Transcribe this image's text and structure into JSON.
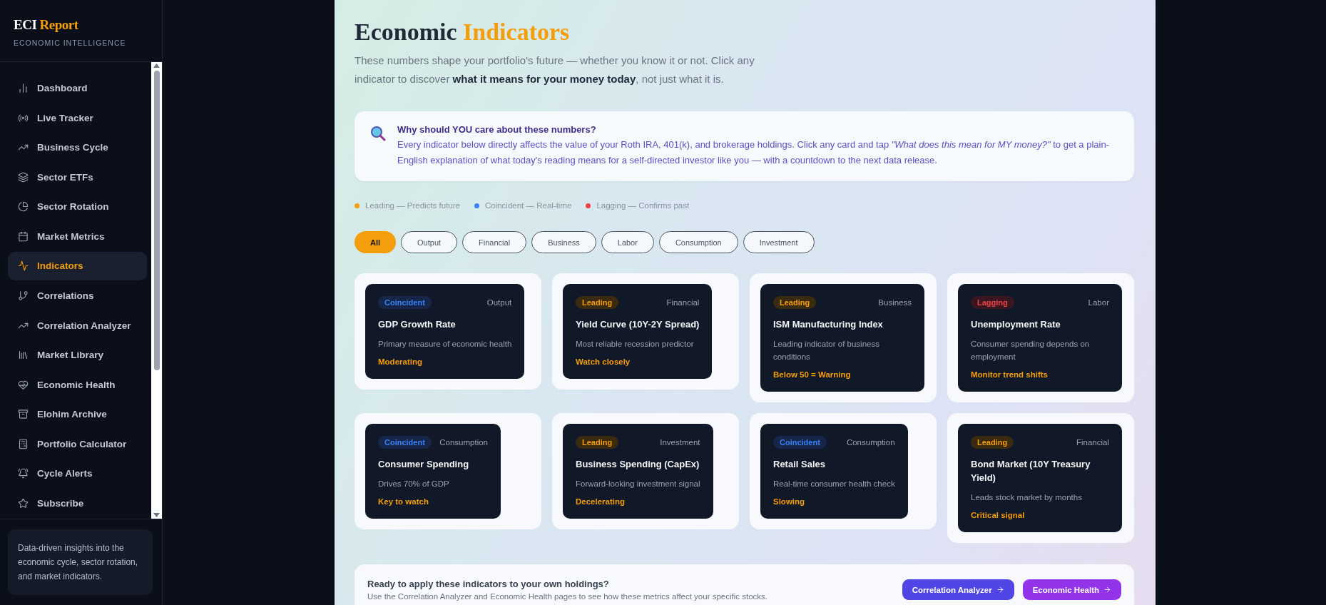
{
  "sidebar": {
    "logo": {
      "primary": "ECI",
      "accent": "Report"
    },
    "subtitle": "ECONOMIC INTELLIGENCE",
    "items": [
      {
        "label": "Dashboard",
        "selected": false
      },
      {
        "label": "Live Tracker",
        "selected": false
      },
      {
        "label": "Business Cycle",
        "selected": false
      },
      {
        "label": "Sector ETFs",
        "selected": false
      },
      {
        "label": "Sector Rotation",
        "selected": false
      },
      {
        "label": "Market Metrics",
        "selected": false
      },
      {
        "label": "Indicators",
        "selected": true
      },
      {
        "label": "Correlations",
        "selected": false
      },
      {
        "label": "Correlation Analyzer",
        "selected": false
      },
      {
        "label": "Market Library",
        "selected": false
      },
      {
        "label": "Economic Health",
        "selected": false
      },
      {
        "label": "Elohim Archive",
        "selected": false
      },
      {
        "label": "Portfolio Calculator",
        "selected": false
      },
      {
        "label": "Cycle Alerts",
        "selected": false
      },
      {
        "label": "Subscribe",
        "selected": false
      }
    ],
    "footer": "Data-driven insights into the economic cycle, sector rotation, and market indicators."
  },
  "header": {
    "title": "Economic",
    "title_accent": "Indicators",
    "intro": "These numbers shape your portfolio's future — whether you know it or not. Click any indicator to discover **what it means for your money today**, not just what it is."
  },
  "info": {
    "title": "Why should YOU care about these numbers?",
    "body": "Every indicator below directly affects the value of your Roth IRA, 401(k), and brokerage holdings. Click any card and tap *\"What does this mean for MY money?\"* to get a plain-English explanation of what today's reading means for a self-directed investor like you — with a countdown to the next data release."
  },
  "legend": [
    {
      "label": "Leading — Predicts future",
      "color": "#f59e0b"
    },
    {
      "label": "Coincident — Real-time",
      "color": "#3b82f6"
    },
    {
      "label": "Lagging — Confirms past",
      "color": "#ef4444"
    }
  ],
  "filters": [
    {
      "label": "All",
      "selected": true
    },
    {
      "label": "Output",
      "selected": false
    },
    {
      "label": "Financial",
      "selected": false
    },
    {
      "label": "Business",
      "selected": false
    },
    {
      "label": "Labor",
      "selected": false
    },
    {
      "label": "Consumption",
      "selected": false
    },
    {
      "label": "Investment",
      "selected": false
    }
  ],
  "cards": [
    {
      "kind": "coincident",
      "badge": "Coincident",
      "sector": "Output",
      "title": "GDP Growth Rate",
      "description": "Primary measure of economic health",
      "signal": "Moderating"
    },
    {
      "kind": "leading",
      "badge": "Leading",
      "sector": "Financial",
      "title": "Yield Curve (10Y-2Y Spread)",
      "description": "Most reliable recession predictor",
      "signal": "Watch closely"
    },
    {
      "kind": "leading",
      "badge": "Leading",
      "sector": "Business",
      "title": "ISM Manufacturing Index",
      "description": "Leading indicator of business conditions",
      "signal": "Below 50 = Warning"
    },
    {
      "kind": "lagging",
      "badge": "Lagging",
      "sector": "Labor",
      "title": "Unemployment Rate",
      "description": "Consumer spending depends on employment",
      "signal": "Monitor trend shifts"
    },
    {
      "kind": "coincident",
      "badge": "Coincident",
      "sector": "Consumption",
      "title": "Consumer Spending",
      "description": "Drives 70% of GDP",
      "signal": "Key to watch"
    },
    {
      "kind": "leading",
      "badge": "Leading",
      "sector": "Investment",
      "title": "Business Spending (CapEx)",
      "description": "Forward-looking investment signal",
      "signal": "Decelerating"
    },
    {
      "kind": "coincident",
      "badge": "Coincident",
      "sector": "Consumption",
      "title": "Retail Sales",
      "description": "Real-time consumer health check",
      "signal": "Slowing"
    },
    {
      "kind": "leading",
      "badge": "Leading",
      "sector": "Financial",
      "title": "Bond Market (10Y Treasury Yield)",
      "description": "Leads stock market by months",
      "signal": "Critical signal"
    }
  ],
  "cta": {
    "title": "Ready to apply these indicators to your own holdings?",
    "text": "Use the Correlation Analyzer and Economic Health pages to see how these metrics affect your specific stocks.",
    "buttons": [
      {
        "label": "Correlation Analyzer",
        "color": "#4f46e5"
      },
      {
        "label": "Economic Health",
        "color": "#9333ea"
      }
    ]
  }
}
